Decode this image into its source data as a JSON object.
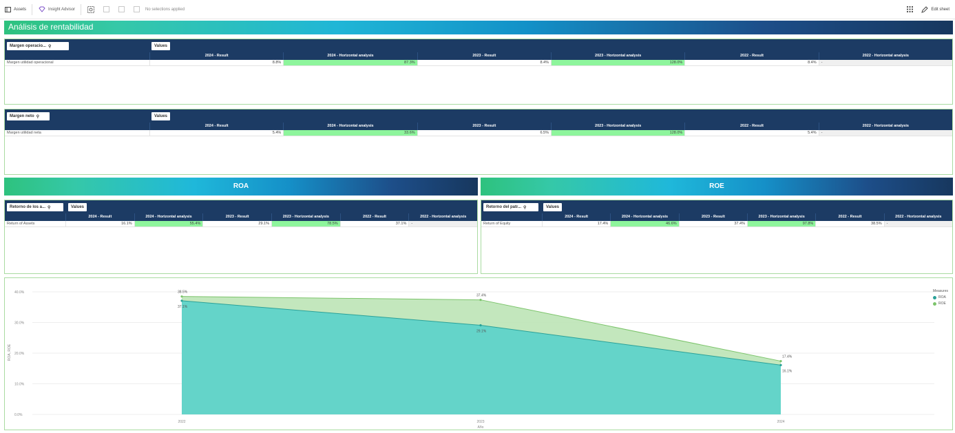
{
  "toolbar": {
    "assets": "Assets",
    "insight_advisor": "Insight Advisor",
    "no_selections": "No selections applied",
    "edit_sheet": "Edit sheet"
  },
  "title": "Análisis de rentabilidad",
  "pivot_operacional": {
    "dimension": "Margen operacio...",
    "values_label": "Values",
    "headers": [
      "2024 - Result",
      "2024 - Horizontal analysis",
      "2023 - Result",
      "2023 - Horizontal analysis",
      "2022 - Result",
      "2022 - Horizontal analysis"
    ],
    "row_label": "Margen utilidad operacional",
    "row_values": [
      "8.8%",
      "87.3%",
      "8.4%",
      "128.0%",
      "8.4%",
      "-"
    ]
  },
  "pivot_neto": {
    "dimension": "Margen neto",
    "values_label": "Values",
    "headers": [
      "2024 - Result",
      "2024 - Horizontal analysis",
      "2023 - Result",
      "2023 - Horizontal analysis",
      "2022 - Result",
      "2022 - Horizontal analysis"
    ],
    "row_label": "Margen utilidad neta",
    "row_values": [
      "5.4%",
      "33.6%",
      "6.5%",
      "128.0%",
      "5.4%",
      "-"
    ]
  },
  "roa": {
    "banner": "ROA",
    "dimension": "Retorno de los a...",
    "values_label": "Values",
    "headers": [
      "2024 - Result",
      "2024 - Horizontal analysis",
      "2023 - Result",
      "2023 - Horizontal analysis",
      "2022 - Result",
      "2022 - Horizontal analysis"
    ],
    "row_label": "Return of Assets",
    "row_values": [
      "16.1%",
      "55.4%",
      "29.1%",
      "78.5%",
      "37.1%",
      "-"
    ]
  },
  "roe": {
    "banner": "ROE",
    "dimension": "Retorno del patr...",
    "values_label": "Values",
    "headers": [
      "2024 - Result",
      "2024 - Horizontal analysis",
      "2023 - Result",
      "2023 - Horizontal analysis",
      "2022 - Result",
      "2022 - Horizontal analysis"
    ],
    "row_label": "Return of Equity",
    "row_values": [
      "17.4%",
      "46.6%",
      "37.4%",
      "97.8%",
      "38.5%",
      "-"
    ]
  },
  "colors": {
    "header_navy": "#1c3b64",
    "highlight_green": "#8ef59c",
    "roa_fill": "#5fd3c9",
    "roe_fill": "#b9e3b1",
    "roa_line": "#2aa198",
    "roe_line": "#7cc46b"
  },
  "chart_data": {
    "type": "area",
    "x": [
      "2022",
      "2023",
      "2024"
    ],
    "xlabel": "Año",
    "ylabel": "ROA, ROE",
    "ylim": [
      0,
      40
    ],
    "y_ticks": [
      "0.0%",
      "10.0%",
      "20.0%",
      "30.0%",
      "40.0%"
    ],
    "grid": true,
    "legend_title": "Measures",
    "legend_position": "top-right",
    "series": [
      {
        "name": "ROA",
        "values": [
          37.1,
          29.1,
          16.1
        ],
        "labels": [
          "37.1%",
          "29.1%",
          "16.1%"
        ]
      },
      {
        "name": "ROE",
        "values": [
          38.5,
          37.4,
          17.4
        ],
        "labels": [
          "38.5%",
          "37.4%",
          "17.4%"
        ]
      }
    ]
  }
}
